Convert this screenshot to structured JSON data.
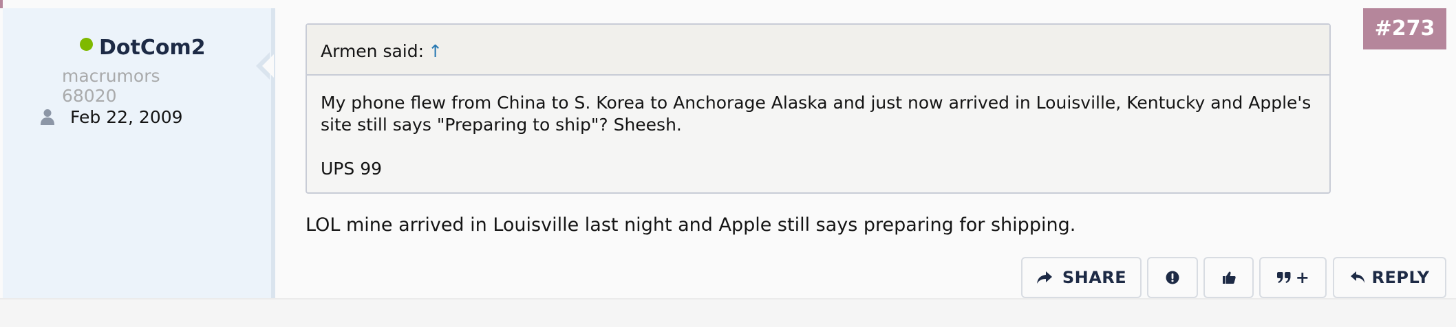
{
  "user": {
    "name": "DotCom2",
    "title": "macrumors 68020",
    "joined": "Feb 22, 2009"
  },
  "post": {
    "number": "#273",
    "quote": {
      "author_line": "Armen said:",
      "arrow": "↑",
      "paragraph1": "My phone flew from China to S. Korea to Anchorage Alaska and just now arrived in Louisville, Kentucky and Apple's site still says \"Preparing to ship\"? Sheesh.",
      "paragraph2": "UPS 99"
    },
    "text": "LOL mine arrived in Louisville last night and Apple still says preparing for shipping."
  },
  "actions": {
    "share": "SHARE",
    "quote_plus": "+",
    "reply": "REPLY"
  },
  "icons": {
    "online": "online-dot",
    "join": "user-icon",
    "share": "share-icon",
    "report": "exclamation-icon",
    "like": "thumbs-up-icon",
    "quote": "quote-icon",
    "reply": "reply-icon"
  },
  "colors": {
    "accent": "#b5869b",
    "online": "#7fb900",
    "link": "#2577b1",
    "username": "#1d2a45",
    "user_bg": "#ecf3fa"
  }
}
